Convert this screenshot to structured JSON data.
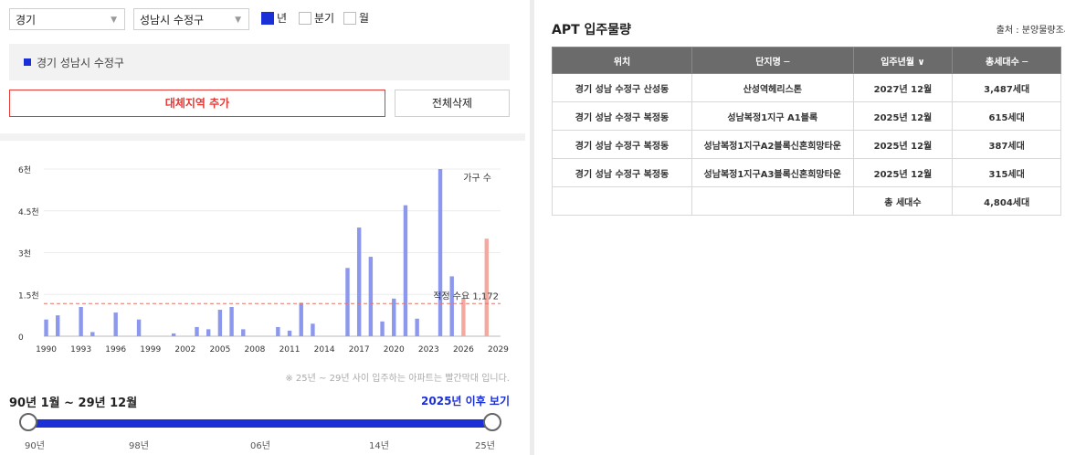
{
  "filters": {
    "province": "경기",
    "city": "성남시 수정구",
    "period_options": [
      {
        "label": "년",
        "checked": true
      },
      {
        "label": "분기",
        "checked": false
      },
      {
        "label": "월",
        "checked": false
      }
    ]
  },
  "region_label": "경기 성남시 수정구",
  "buttons": {
    "add_region": "대체지역 추가",
    "delete_all": "전체삭제"
  },
  "note": "※ 25년 ~ 29년 사이 입주하는 아파트는 빨간막대 입니다.",
  "range_label": "90년 1월 ~ 29년 12월",
  "after_link": "2025년 이후 보기",
  "slider_ticks": [
    "90년",
    "98년",
    "06년",
    "14년",
    "25년"
  ],
  "chart_data": {
    "type": "bar",
    "legend_label": "가구 수",
    "x_ticks": [
      1990,
      1993,
      1996,
      1999,
      2002,
      2005,
      2008,
      2011,
      2014,
      2017,
      2020,
      2023,
      2026,
      2029
    ],
    "y_ticks": [
      {
        "v": 0,
        "label": "0"
      },
      {
        "v": 1500,
        "label": "1.5천"
      },
      {
        "v": 3000,
        "label": "3천"
      },
      {
        "v": 4500,
        "label": "4.5천"
      },
      {
        "v": 6000,
        "label": "6천"
      }
    ],
    "ylim": [
      0,
      6000
    ],
    "xlim": [
      1989.8,
      2029.2
    ],
    "reference_line": {
      "label": "적정 수요 1,172",
      "value": 1172
    },
    "colors": {
      "normal": "#8c97ee",
      "future": "#f3a9a0",
      "reference": "#e57368"
    },
    "bars": [
      {
        "x": 1990,
        "v": 600
      },
      {
        "x": 1991,
        "v": 750
      },
      {
        "x": 1993,
        "v": 1050
      },
      {
        "x": 1994,
        "v": 150
      },
      {
        "x": 1996,
        "v": 850
      },
      {
        "x": 1998,
        "v": 600
      },
      {
        "x": 2001,
        "v": 100
      },
      {
        "x": 2003,
        "v": 330
      },
      {
        "x": 2004,
        "v": 250
      },
      {
        "x": 2005,
        "v": 950
      },
      {
        "x": 2006,
        "v": 1050
      },
      {
        "x": 2007,
        "v": 250
      },
      {
        "x": 2010,
        "v": 330
      },
      {
        "x": 2011,
        "v": 200
      },
      {
        "x": 2012,
        "v": 1200
      },
      {
        "x": 2013,
        "v": 450
      },
      {
        "x": 2016,
        "v": 2450
      },
      {
        "x": 2017,
        "v": 3900
      },
      {
        "x": 2018,
        "v": 2850
      },
      {
        "x": 2019,
        "v": 530
      },
      {
        "x": 2020,
        "v": 1350
      },
      {
        "x": 2021,
        "v": 4700
      },
      {
        "x": 2022,
        "v": 630
      },
      {
        "x": 2024,
        "v": 6000
      },
      {
        "x": 2025,
        "v": 2150
      },
      {
        "x": 2026,
        "v": 1350,
        "future": true
      },
      {
        "x": 2028,
        "v": 3500,
        "future": true
      }
    ]
  },
  "table": {
    "title": "APT 입주물량",
    "source": "출처 : 분양물량조사",
    "headers": [
      "위치",
      "단지명 ─",
      "입주년월 ∨",
      "총세대수 ─"
    ],
    "rows": [
      [
        "경기 성남 수정구 산성동",
        "산성역헤리스톤",
        "2027년 12월",
        "3,487세대"
      ],
      [
        "경기 성남 수정구 복정동",
        "성남복정1지구 A1블록",
        "2025년 12월",
        "615세대"
      ],
      [
        "경기 성남 수정구 복정동",
        "성남복정1지구A2블록신혼희망타운",
        "2025년 12월",
        "387세대"
      ],
      [
        "경기 성남 수정구 복정동",
        "성남복정1지구A3블록신혼희망타운",
        "2025년 12월",
        "315세대"
      ]
    ],
    "total": {
      "label": "총 세대수",
      "value": "4,804세대"
    }
  }
}
